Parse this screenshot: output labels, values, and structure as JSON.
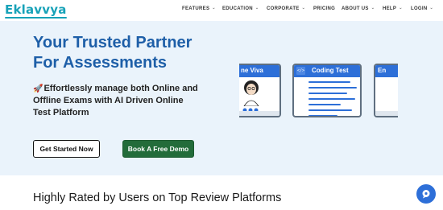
{
  "brand": {
    "logo_text": "Eklavvya",
    "accent_color": "#17a2b8"
  },
  "nav": {
    "items": [
      {
        "label": "FEATURES",
        "has_dropdown": true
      },
      {
        "label": "EDUCATION",
        "has_dropdown": true
      },
      {
        "label": "CORPORATE",
        "has_dropdown": true
      },
      {
        "label": "PRICING",
        "has_dropdown": false
      },
      {
        "label": "ABOUT US",
        "has_dropdown": true
      },
      {
        "label": "HELP",
        "has_dropdown": true
      },
      {
        "label": "LOGIN",
        "has_dropdown": true
      }
    ],
    "chevron_glyph": "⌄"
  },
  "hero": {
    "headline_line1": "Your Trusted Partner",
    "headline_line2": "For Assessments",
    "subtext_icon": "🚀",
    "subtext": "Effortlessly manage both Online and Offline Exams with AI Driven Online Test Platform",
    "primary_button": "Get Started Now",
    "secondary_button": "Book A Free Demo",
    "cards": [
      {
        "title": "ne Viva",
        "icon": "avatar-icon"
      },
      {
        "title": "Coding Test",
        "icon": "code-icon",
        "icon_glyph": "</>"
      },
      {
        "title": "En",
        "icon": "none"
      }
    ],
    "colors": {
      "headline": "#1e5fa8",
      "demo_button": "#236c3a",
      "background": "#eaf3fb"
    }
  },
  "section": {
    "title": "Highly Rated by Users on Top Review Platforms"
  },
  "chat": {
    "icon": "chat-bubble-icon"
  }
}
